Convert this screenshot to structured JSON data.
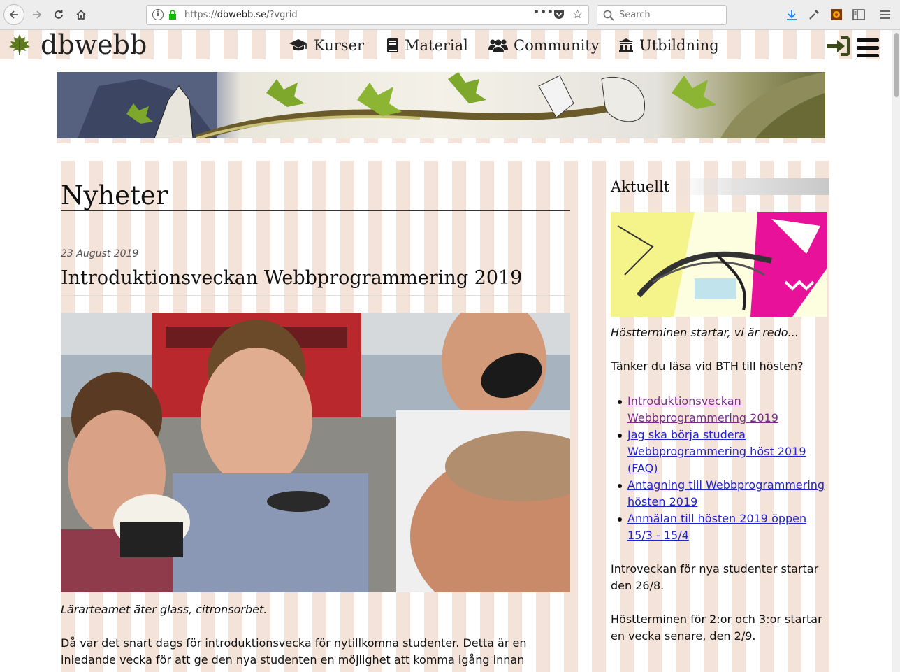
{
  "browser": {
    "url_prefix": "https://",
    "url_domain": "dbwebb.se",
    "url_path": "/?vgrid",
    "search_placeholder": "Search",
    "page_actions": "•••"
  },
  "site": {
    "title": "dbwebb",
    "nav": [
      {
        "label": "Kurser",
        "icon": "graduation-cap-icon"
      },
      {
        "label": "Material",
        "icon": "book-icon"
      },
      {
        "label": "Community",
        "icon": "users-icon"
      },
      {
        "label": "Utbildning",
        "icon": "university-icon"
      }
    ]
  },
  "main": {
    "page_title": "Nyheter",
    "post": {
      "date": "23 August 2019",
      "title": "Introduktionsveckan Webbprogrammering 2019",
      "caption": "Lärarteamet äter glass, citronsorbet.",
      "body": "Då var det snart dags för introduktionsvecka för nytillkomna studenter. Detta är en inledande vecka för att ge den nya studenten en möjlighet att komma igång innan"
    }
  },
  "aside": {
    "title": "Aktuellt",
    "intro": "Höstterminen startar, vi är redo...",
    "question": "Tänker du läsa vid BTH till hösten?",
    "links": [
      {
        "label": "Introduktionsveckan Webbprogrammering 2019",
        "visited": true
      },
      {
        "label": "Jag ska börja studera Webbprogrammering höst 2019 (FAQ)",
        "visited": false
      },
      {
        "label": "Antagning till Webbprogrammering hösten 2019",
        "visited": false
      },
      {
        "label": "Anmälan till hösten 2019 öppen 15/3 - 15/4",
        "visited": false
      }
    ],
    "intro_week": "Introveckan för nya studenter startar den 26/8.",
    "second_year": "Höstterminen för 2:or och 3:or startar en vecka senare, den 2/9."
  },
  "colors": {
    "stripe": "#f3e3d9",
    "link": "#2323c8",
    "visited_link": "#7a2a8a",
    "login_icon": "#3f4a1c"
  }
}
